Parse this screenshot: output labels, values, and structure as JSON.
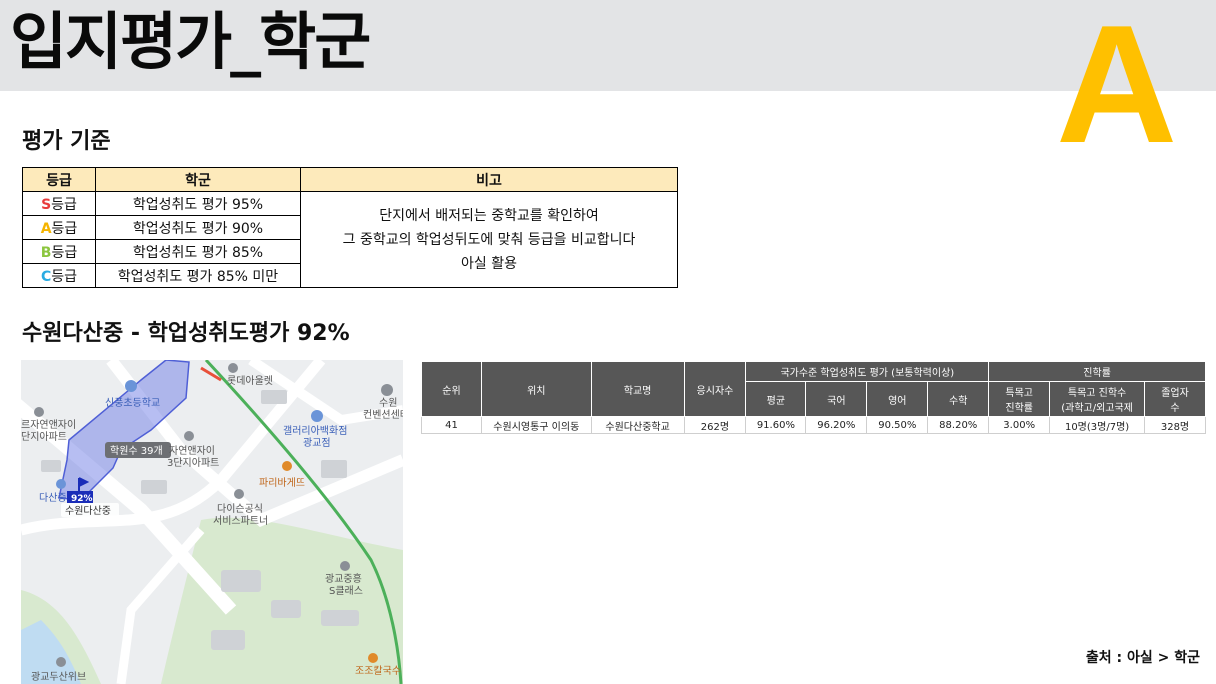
{
  "header": {
    "title": "입지평가_학군",
    "grade": "A"
  },
  "criteria": {
    "title": "평가 기준",
    "headers": [
      "등급",
      "학군",
      "비고"
    ],
    "rows": [
      {
        "letter": "S",
        "suffix": "등급",
        "color": "#e83c3c",
        "desc": "학업성취도 평가 95%"
      },
      {
        "letter": "A",
        "suffix": "등급",
        "color": "#f5b400",
        "desc": "학업성취도 평가 90%"
      },
      {
        "letter": "B",
        "suffix": "등급",
        "color": "#8cc63f",
        "desc": "학업성취도 평가 85%"
      },
      {
        "letter": "C",
        "suffix": "등급",
        "color": "#29abe2",
        "desc": "학업성취도 평가 85% 미만"
      }
    ],
    "note_lines": [
      "단지에서 배저되는 중학교를 확인하여",
      "그 중학교의 학업성뒤도에 맞춰 등급을 비교합니다",
      "아실 활용"
    ]
  },
  "school": {
    "title": "수원다산중 - 학업성취도평가 92%",
    "map": {
      "labels": {
        "lotte": "롯데아울렛",
        "suwon_conv_1": "수원",
        "suwon_conv_2": "컨벤션센터",
        "sinpung": "신풍초등학교",
        "apt_left_1": "르자연앤자이",
        "apt_left_2": "단지아파트",
        "galleria_1": "갤러리아백화점",
        "galleria_2": "광교점",
        "students": "학원수 39개",
        "apt3_1": "자연앤자이",
        "apt3_2": "3단지아파트",
        "paris": "파리바게뜨",
        "dasan_short": "다산중",
        "pct": "92%",
        "school": "수원다산중",
        "daison_1": "다이슨공식",
        "daison_2": "서비스파트너",
        "gwanggyo_1": "광교중흥",
        "gwanggyo_2": "S클래스",
        "jojo": "조조칼국수",
        "doosan": "광교두산위브"
      }
    },
    "table": {
      "group_national": "국가수준 학업성취도 평가 (보통학력이상)",
      "group_advance": "진학률",
      "columns": {
        "rank": "순위",
        "location": "위치",
        "school": "학교명",
        "takers": "응시자수",
        "avg": "평균",
        "kor": "국어",
        "eng": "영어",
        "math": "수학",
        "special_1": "특목고",
        "special_2": "진학률",
        "count_1": "특목고 진학수",
        "count_2": "(과학고/외고국제",
        "grads_1": "졸업자",
        "grads_2": "수"
      },
      "row": {
        "rank": "41",
        "location": "수원시영통구 이의동",
        "school": "수원다산중학교",
        "takers": "262명",
        "avg": "91.60%",
        "kor": "96.20%",
        "eng": "90.50%",
        "math": "88.20%",
        "special_rate": "3.00%",
        "special_count": "10명(3명/7명)",
        "grads": "328명"
      }
    }
  },
  "source": "출처 : 아실 > 학군",
  "colors": {
    "grade_accent": "#ffc000",
    "header_band": "#e3e4e6",
    "table_header": "#575757",
    "criteria_header": "#fdeabb"
  }
}
